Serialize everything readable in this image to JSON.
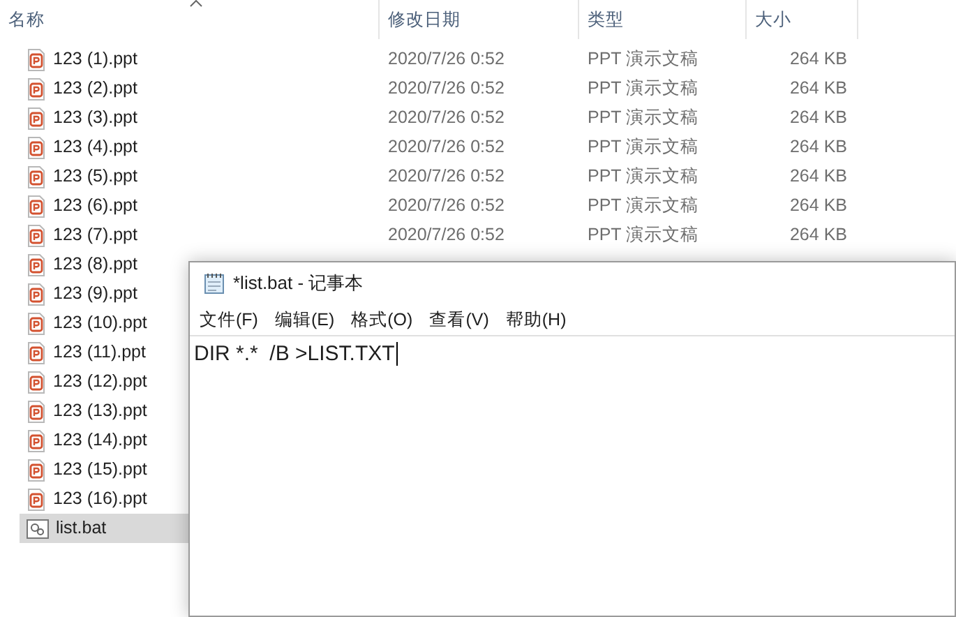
{
  "explorer": {
    "columns": [
      "名称",
      "修改日期",
      "类型",
      "大小"
    ],
    "files": [
      {
        "name": "123 (1).ppt",
        "kind": "ppt",
        "date": "2020/7/26 0:52",
        "type": "PPT 演示文稿",
        "size": "264 KB",
        "selected": false
      },
      {
        "name": "123 (2).ppt",
        "kind": "ppt",
        "date": "2020/7/26 0:52",
        "type": "PPT 演示文稿",
        "size": "264 KB",
        "selected": false
      },
      {
        "name": "123 (3).ppt",
        "kind": "ppt",
        "date": "2020/7/26 0:52",
        "type": "PPT 演示文稿",
        "size": "264 KB",
        "selected": false
      },
      {
        "name": "123 (4).ppt",
        "kind": "ppt",
        "date": "2020/7/26 0:52",
        "type": "PPT 演示文稿",
        "size": "264 KB",
        "selected": false
      },
      {
        "name": "123 (5).ppt",
        "kind": "ppt",
        "date": "2020/7/26 0:52",
        "type": "PPT 演示文稿",
        "size": "264 KB",
        "selected": false
      },
      {
        "name": "123 (6).ppt",
        "kind": "ppt",
        "date": "2020/7/26 0:52",
        "type": "PPT 演示文稿",
        "size": "264 KB",
        "selected": false
      },
      {
        "name": "123 (7).ppt",
        "kind": "ppt",
        "date": "2020/7/26 0:52",
        "type": "PPT 演示文稿",
        "size": "264 KB",
        "selected": false
      },
      {
        "name": "123 (8).ppt",
        "kind": "ppt",
        "selected": false
      },
      {
        "name": "123 (9).ppt",
        "kind": "ppt",
        "selected": false
      },
      {
        "name": "123 (10).ppt",
        "kind": "ppt",
        "selected": false
      },
      {
        "name": "123 (11).ppt",
        "kind": "ppt",
        "selected": false
      },
      {
        "name": "123 (12).ppt",
        "kind": "ppt",
        "selected": false
      },
      {
        "name": "123 (13).ppt",
        "kind": "ppt",
        "selected": false
      },
      {
        "name": "123 (14).ppt",
        "kind": "ppt",
        "selected": false
      },
      {
        "name": "123 (15).ppt",
        "kind": "ppt",
        "selected": false
      },
      {
        "name": "123 (16).ppt",
        "kind": "ppt",
        "selected": false
      },
      {
        "name": "list.bat",
        "kind": "bat",
        "selected": true
      }
    ]
  },
  "notepad": {
    "title": "*list.bat - 记事本",
    "menu": [
      "文件(F)",
      "编辑(E)",
      "格式(O)",
      "查看(V)",
      "帮助(H)"
    ],
    "text": "DIR *.*  /B >LIST.TXT"
  }
}
